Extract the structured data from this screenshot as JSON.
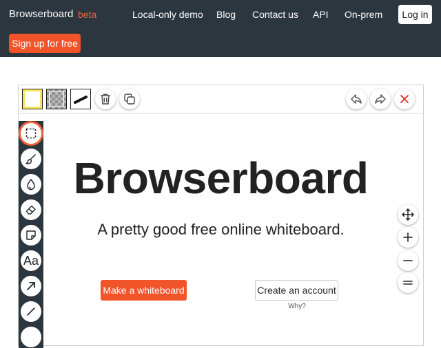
{
  "nav": {
    "brand": "Browserboard",
    "beta": "beta",
    "links": [
      "Local-only demo",
      "Blog",
      "Contact us",
      "API",
      "On-prem"
    ],
    "login": "Log in",
    "signup": "Sign up for free"
  },
  "toolbar": {
    "fill_color": "#f5e65b",
    "icons": [
      "fill-color-swatch",
      "transparent-swatch",
      "stroke-width-swatch",
      "trash-icon",
      "duplicate-icon",
      "undo-icon",
      "redo-icon",
      "close-icon"
    ]
  },
  "tools": {
    "icons": [
      "select-icon",
      "brush-icon",
      "ink-drop-icon",
      "eraser-icon",
      "sticky-note-icon",
      "text-icon",
      "arrow-icon",
      "line-icon"
    ],
    "text_tool_label": "Aa"
  },
  "view_controls": {
    "icons": [
      "pan-icon",
      "zoom-in-icon",
      "zoom-out-icon",
      "reset-zoom-icon"
    ]
  },
  "hero": {
    "title": "Browserboard",
    "subtitle": "A pretty good free online whiteboard.",
    "make_button": "Make a whiteboard",
    "create_button": "Create an account",
    "why": "Why?"
  },
  "colors": {
    "nav_bg": "#2c363f",
    "accent": "#f2542a",
    "beta": "#f2613a"
  }
}
